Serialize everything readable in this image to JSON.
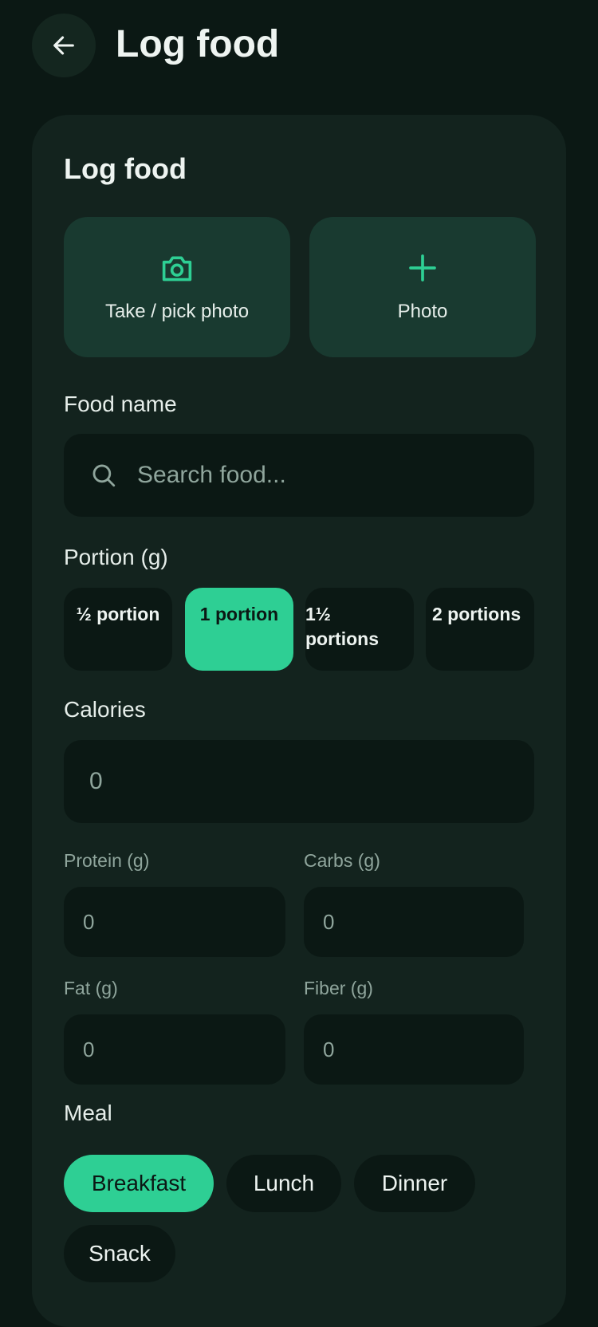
{
  "header": {
    "title": "Log food",
    "back_icon": "arrow-left-icon"
  },
  "card": {
    "title": "Log food",
    "photo_buttons": [
      {
        "label": "Take / pick photo",
        "icon": "camera-icon"
      },
      {
        "label": "Photo",
        "icon": "plus-icon"
      }
    ]
  },
  "food_name": {
    "label": "Food name",
    "placeholder": "Search food..."
  },
  "portion": {
    "label": "Portion (g)",
    "options": [
      "½ portion",
      "1 portion",
      "1½ portions",
      "2 portions"
    ],
    "selected": "1 portion"
  },
  "calories": {
    "label": "Calories",
    "value": "0"
  },
  "macros": {
    "protein": {
      "label": "Protein (g)",
      "value": "0"
    },
    "carbs": {
      "label": "Carbs (g)",
      "value": "0"
    },
    "fat": {
      "label": "Fat (g)",
      "value": "0"
    },
    "fiber": {
      "label": "Fiber (g)",
      "value": "0"
    }
  },
  "meal": {
    "label": "Meal",
    "options": [
      "Breakfast",
      "Lunch",
      "Dinner",
      "Snack"
    ],
    "selected": "Breakfast"
  },
  "colors": {
    "background": "#0b1814",
    "card": "#13231e",
    "accent": "#2ecf94",
    "tile": "#193a30"
  }
}
